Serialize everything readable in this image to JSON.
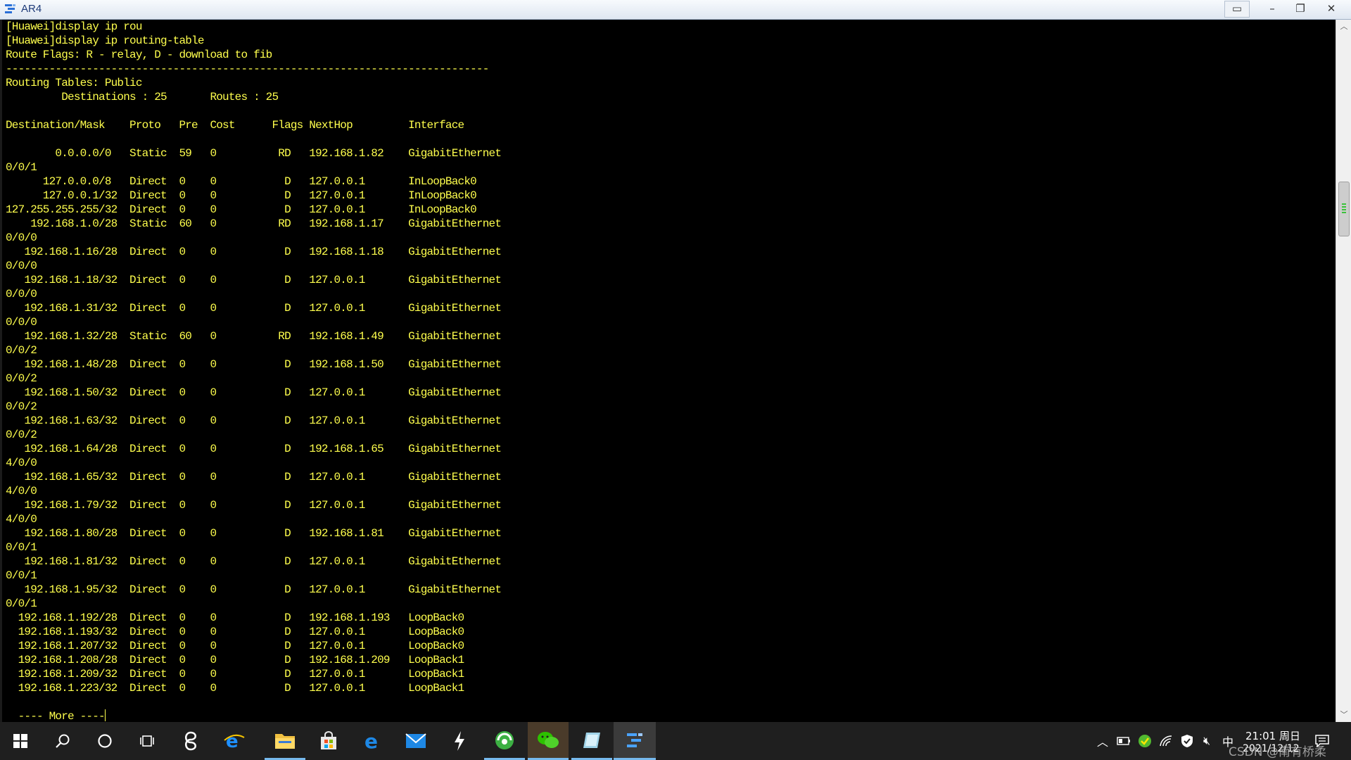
{
  "window": {
    "title": "AR4",
    "min_icon": "minimize-icon",
    "max_icon": "restore-icon",
    "close_icon": "close-icon",
    "extra_icon": "window-layout-icon"
  },
  "terminal": {
    "text_color": "#ffff4d",
    "background": "#000000",
    "lines": [
      "[Huawei]display ip rou",
      "[Huawei]display ip routing-table",
      "Route Flags: R - relay, D - download to fib",
      "------------------------------------------------------------------------------",
      "Routing Tables: Public",
      "         Destinations : 25       Routes : 25",
      "",
      "Destination/Mask    Proto   Pre  Cost      Flags NextHop         Interface",
      "",
      "        0.0.0.0/0   Static  59   0          RD   192.168.1.82    GigabitEthernet",
      "0/0/1",
      "      127.0.0.0/8   Direct  0    0           D   127.0.0.1       InLoopBack0",
      "      127.0.0.1/32  Direct  0    0           D   127.0.0.1       InLoopBack0",
      "127.255.255.255/32  Direct  0    0           D   127.0.0.1       InLoopBack0",
      "    192.168.1.0/28  Static  60   0          RD   192.168.1.17    GigabitEthernet",
      "0/0/0",
      "   192.168.1.16/28  Direct  0    0           D   192.168.1.18    GigabitEthernet",
      "0/0/0",
      "   192.168.1.18/32  Direct  0    0           D   127.0.0.1       GigabitEthernet",
      "0/0/0",
      "   192.168.1.31/32  Direct  0    0           D   127.0.0.1       GigabitEthernet",
      "0/0/0",
      "   192.168.1.32/28  Static  60   0          RD   192.168.1.49    GigabitEthernet",
      "0/0/2",
      "   192.168.1.48/28  Direct  0    0           D   192.168.1.50    GigabitEthernet",
      "0/0/2",
      "   192.168.1.50/32  Direct  0    0           D   127.0.0.1       GigabitEthernet",
      "0/0/2",
      "   192.168.1.63/32  Direct  0    0           D   127.0.0.1       GigabitEthernet",
      "0/0/2",
      "   192.168.1.64/28  Direct  0    0           D   192.168.1.65    GigabitEthernet",
      "4/0/0",
      "   192.168.1.65/32  Direct  0    0           D   127.0.0.1       GigabitEthernet",
      "4/0/0",
      "   192.168.1.79/32  Direct  0    0           D   127.0.0.1       GigabitEthernet",
      "4/0/0",
      "   192.168.1.80/28  Direct  0    0           D   192.168.1.81    GigabitEthernet",
      "0/0/1",
      "   192.168.1.81/32  Direct  0    0           D   127.0.0.1       GigabitEthernet",
      "0/0/1",
      "   192.168.1.95/32  Direct  0    0           D   127.0.0.1       GigabitEthernet",
      "0/0/1",
      "  192.168.1.192/28  Direct  0    0           D   192.168.1.193   LoopBack0",
      "  192.168.1.193/32  Direct  0    0           D   127.0.0.1       LoopBack0",
      "  192.168.1.207/32  Direct  0    0           D   127.0.0.1       LoopBack0",
      "  192.168.1.208/28  Direct  0    0           D   192.168.1.209   LoopBack1",
      "  192.168.1.209/32  Direct  0    0           D   127.0.0.1       LoopBack1",
      "  192.168.1.223/32  Direct  0    0           D   127.0.0.1       LoopBack1"
    ],
    "more_prompt": "  ---- More ----"
  },
  "scrollbar": {
    "up_icon": "scroll-up-arrow-icon",
    "down_icon": "scroll-down-arrow-icon"
  },
  "taskbar": {
    "background": "#1f1f1f",
    "accent": "#76b9ed",
    "items": [
      {
        "name": "start-button",
        "icon": "windows-logo-icon"
      },
      {
        "name": "search-button",
        "icon": "search-icon"
      },
      {
        "name": "cortana-button",
        "icon": "cortana-circle-icon"
      },
      {
        "name": "task-view-button",
        "icon": "task-view-icon"
      },
      {
        "name": "taskbar-app-1",
        "icon": "swirl-app-icon"
      },
      {
        "name": "taskbar-ie",
        "icon": "internet-explorer-icon"
      },
      {
        "name": "taskbar-file-explorer",
        "icon": "folder-icon"
      },
      {
        "name": "taskbar-store",
        "icon": "store-icon"
      },
      {
        "name": "taskbar-edge",
        "icon": "edge-icon"
      },
      {
        "name": "taskbar-mail",
        "icon": "mail-icon"
      },
      {
        "name": "taskbar-app-bolt",
        "icon": "bolt-icon"
      },
      {
        "name": "taskbar-browser-360",
        "icon": "browser-360-icon"
      },
      {
        "name": "taskbar-wechat",
        "icon": "wechat-icon"
      },
      {
        "name": "taskbar-ensp",
        "icon": "ensp-icon"
      },
      {
        "name": "taskbar-ar-console",
        "icon": "console-app-icon"
      }
    ],
    "tray": {
      "ime": "中",
      "time": "21:01 周日",
      "date": "2021/12/12",
      "watermark": "CSDN @南有桥柔"
    }
  }
}
